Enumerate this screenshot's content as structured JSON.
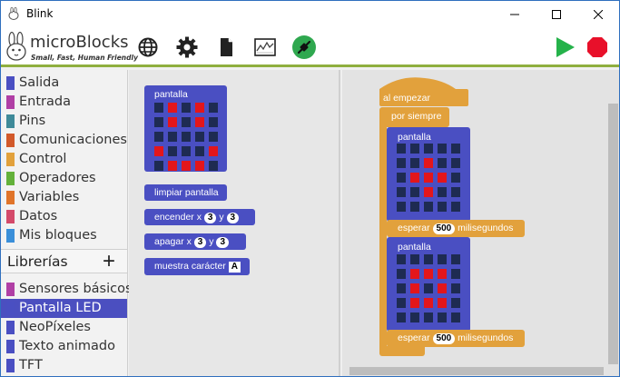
{
  "window": {
    "title": "Blink"
  },
  "toolbar": {
    "logo": "microBlocks",
    "tagline": "Small, Fast, Human Friendly",
    "icons": [
      "globe-icon",
      "gear-icon",
      "file-icon",
      "graph-icon",
      "connection-icon",
      "play-icon",
      "stop-icon"
    ],
    "accent": "#8faf3f"
  },
  "categories": [
    {
      "label": "Salida",
      "color": "#4a4fc2"
    },
    {
      "label": "Entrada",
      "color": "#b03fa5"
    },
    {
      "label": "Pins",
      "color": "#3f8a99"
    },
    {
      "label": "Comunicaciones",
      "color": "#d2592a"
    },
    {
      "label": "Control",
      "color": "#e2a13c"
    },
    {
      "label": "Operadores",
      "color": "#63b13a"
    },
    {
      "label": "Variables",
      "color": "#e0742a"
    },
    {
      "label": "Datos",
      "color": "#d44a6a"
    },
    {
      "label": "Mis bloques",
      "color": "#3a8fd9"
    }
  ],
  "libraries": {
    "title": "Librerías",
    "add": "+",
    "items": [
      {
        "label": "Sensores básicos",
        "color": "#b03fa5",
        "selected": false
      },
      {
        "label": "Pantalla LED",
        "color": "#4a4fc2",
        "selected": true
      },
      {
        "label": "NeoPíxeles",
        "color": "#4a4fc2",
        "selected": false
      },
      {
        "label": "Texto animado",
        "color": "#4a4fc2",
        "selected": false
      },
      {
        "label": "TFT",
        "color": "#4a4fc2",
        "selected": false
      }
    ]
  },
  "palette": {
    "display_label": "pantalla",
    "display_grid": [
      [
        0,
        1,
        0,
        1,
        0
      ],
      [
        0,
        1,
        0,
        1,
        0
      ],
      [
        0,
        0,
        0,
        0,
        0
      ],
      [
        1,
        0,
        0,
        0,
        1
      ],
      [
        0,
        1,
        1,
        1,
        0
      ]
    ],
    "clear": "limpiar pantalla",
    "plot_label": "encender x",
    "plot_x": "3",
    "plot_y_label": "y",
    "plot_y": "3",
    "unplot_label": "apagar x",
    "unplot_x": "3",
    "unplot_y_label": "y",
    "unplot_y": "3",
    "char_label": "muestra carácter",
    "char_value": "A"
  },
  "script": {
    "hat": "al empezar",
    "forever": "por siempre",
    "display1_label": "pantalla",
    "display1_grid": [
      [
        0,
        0,
        0,
        0,
        0
      ],
      [
        0,
        0,
        1,
        0,
        0
      ],
      [
        0,
        1,
        1,
        1,
        0
      ],
      [
        0,
        0,
        1,
        0,
        0
      ],
      [
        0,
        0,
        0,
        0,
        0
      ]
    ],
    "wait1_label": "esperar",
    "wait1_value": "500",
    "wait1_unit": "milisegundos",
    "display2_label": "pantalla",
    "display2_grid": [
      [
        0,
        0,
        0,
        0,
        0
      ],
      [
        0,
        1,
        1,
        1,
        0
      ],
      [
        0,
        1,
        0,
        1,
        0
      ],
      [
        0,
        1,
        1,
        1,
        0
      ],
      [
        0,
        0,
        0,
        0,
        0
      ]
    ],
    "wait2_label": "esperar",
    "wait2_value": "500",
    "wait2_unit": "milisegundos"
  }
}
